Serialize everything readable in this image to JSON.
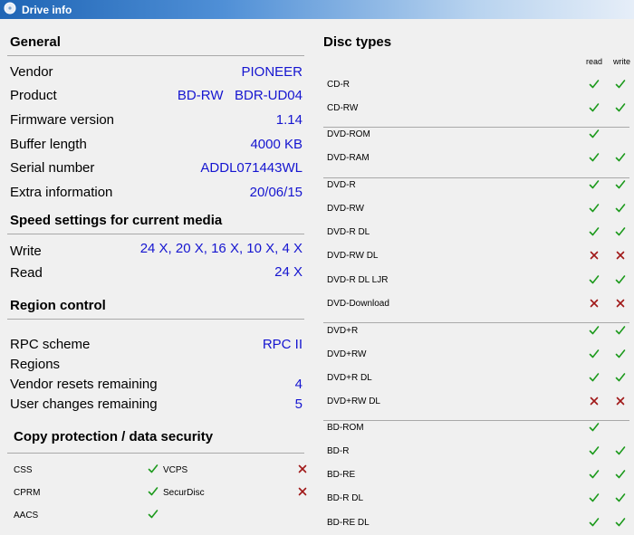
{
  "window": {
    "title": "Drive info"
  },
  "general": {
    "heading": "General",
    "rows": [
      {
        "label": "Vendor",
        "value": "PIONEER"
      },
      {
        "label": "Product",
        "value": "BD-RW   BDR-UD04"
      },
      {
        "label": "Firmware version",
        "value": "1.14"
      },
      {
        "label": "Buffer length",
        "value": "4000 KB"
      },
      {
        "label": "Serial number",
        "value": "ADDL071443WL"
      },
      {
        "label": "Extra information",
        "value": "20/06/15"
      }
    ]
  },
  "speed": {
    "heading": "Speed settings for current media",
    "rows": [
      {
        "label": "Write",
        "value": "24 X, 20 X, 16 X, 10 X, 4 X"
      },
      {
        "label": "Read",
        "value": "24 X"
      }
    ]
  },
  "region": {
    "heading": "Region control",
    "rows": [
      {
        "label": "RPC scheme",
        "value": "RPC II"
      },
      {
        "label": "Regions",
        "value": ""
      },
      {
        "label": "Vendor resets remaining",
        "value": "4"
      },
      {
        "label": "User changes remaining",
        "value": "5"
      }
    ]
  },
  "copy_protection": {
    "heading": "Copy protection / data security",
    "items": [
      {
        "name": "CSS",
        "icon": "check-icon"
      },
      {
        "name": "VCPS",
        "icon": "cross-icon"
      },
      {
        "name": "CPRM",
        "icon": "check-icon"
      },
      {
        "name": "SecurDisc",
        "icon": "cross-icon"
      },
      {
        "name": "AACS",
        "icon": "check-icon"
      }
    ]
  },
  "disc_types": {
    "heading": "Disc types",
    "col_read": "read",
    "col_write": "write",
    "items": [
      {
        "name": "CD-R",
        "read": "check-icon",
        "write": "check-icon"
      },
      {
        "name": "CD-RW",
        "read": "check-icon",
        "write": "check-icon"
      },
      {
        "name": "DVD-ROM",
        "read": "check-icon",
        "write": ""
      },
      {
        "name": "DVD-RAM",
        "read": "check-icon",
        "write": "check-icon"
      },
      {
        "name": "DVD-R",
        "read": "check-icon",
        "write": "check-icon"
      },
      {
        "name": "DVD-RW",
        "read": "check-icon",
        "write": "check-icon"
      },
      {
        "name": "DVD-R DL",
        "read": "check-icon",
        "write": "check-icon"
      },
      {
        "name": "DVD-RW DL",
        "read": "cross-icon",
        "write": "cross-icon"
      },
      {
        "name": "DVD-R DL LJR",
        "read": "check-icon",
        "write": "check-icon"
      },
      {
        "name": "DVD-Download",
        "read": "cross-icon",
        "write": "cross-icon"
      },
      {
        "name": "DVD+R",
        "read": "check-icon",
        "write": "check-icon"
      },
      {
        "name": "DVD+RW",
        "read": "check-icon",
        "write": "check-icon"
      },
      {
        "name": "DVD+R DL",
        "read": "check-icon",
        "write": "check-icon"
      },
      {
        "name": "DVD+RW DL",
        "read": "cross-icon",
        "write": "cross-icon"
      },
      {
        "name": "BD-ROM",
        "read": "check-icon",
        "write": ""
      },
      {
        "name": "BD-R",
        "read": "check-icon",
        "write": "check-icon"
      },
      {
        "name": "BD-RE",
        "read": "check-icon",
        "write": "check-icon"
      },
      {
        "name": "BD-R DL",
        "read": "check-icon",
        "write": "check-icon"
      },
      {
        "name": "BD-RE DL",
        "read": "check-icon",
        "write": "check-icon"
      }
    ]
  },
  "colors": {
    "check": "#1d9a1d",
    "cross": "#a01818",
    "value": "#1515d0"
  }
}
